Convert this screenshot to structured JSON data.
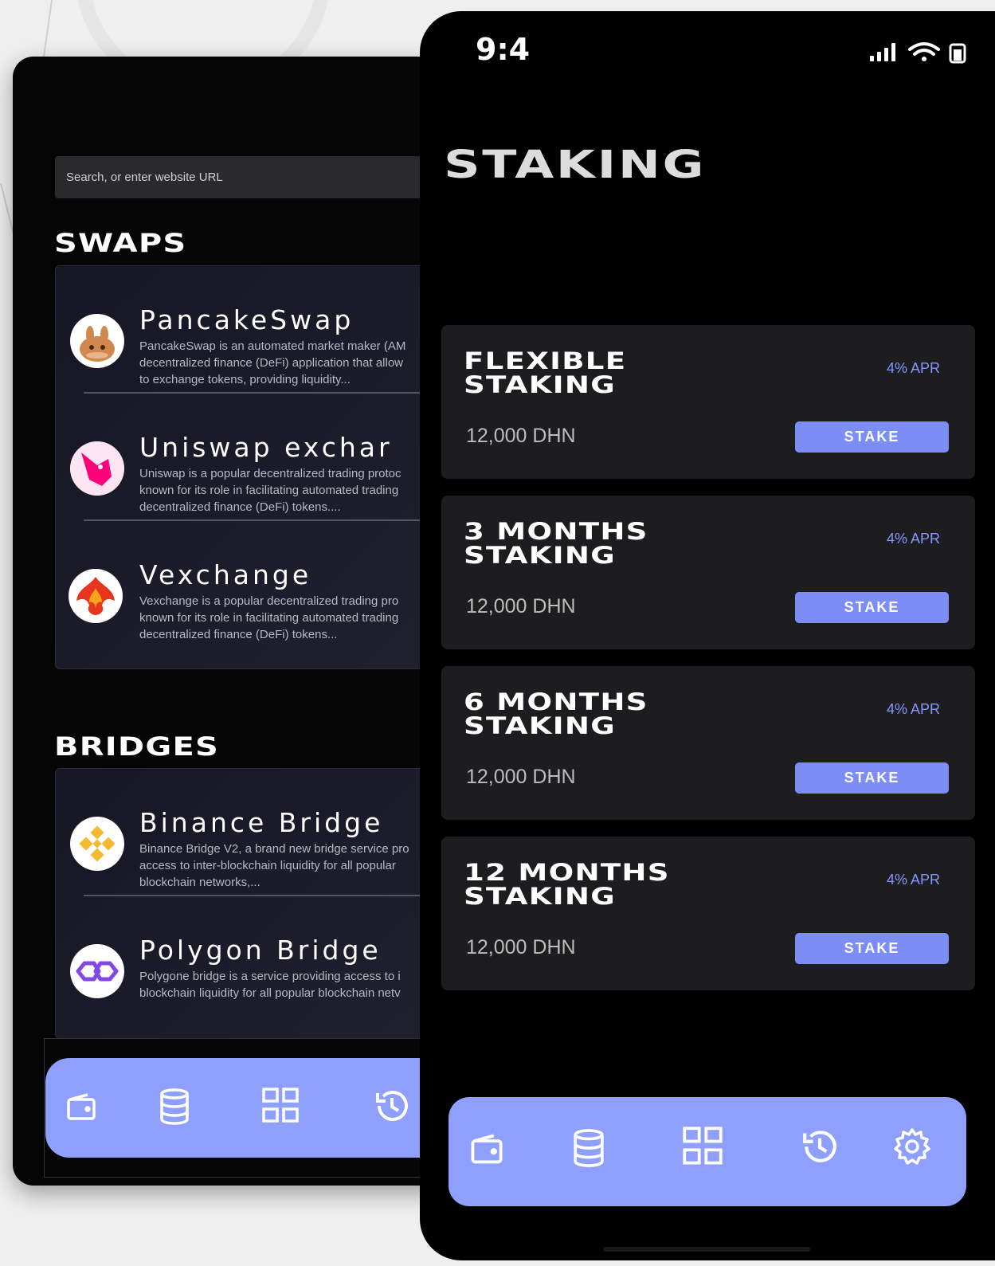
{
  "back_screen": {
    "search": {
      "placeholder": "Search, or enter website URL"
    },
    "swaps_title": "SWAPS",
    "swaps": [
      {
        "name": "PancakeSwap",
        "description": "PancakeSwap is an automated market maker (AM\ndecentralized finance (DeFi) application that allow\nto exchange tokens, providing liquidity...",
        "icon": "pancakeswap-logo"
      },
      {
        "name": "Uniswap exchar",
        "description": "Uniswap is a popular decentralized trading protoc\nknown for its role in facilitating automated trading\ndecentralized finance (DeFi) tokens....",
        "icon": "uniswap-logo"
      },
      {
        "name": "Vexchange",
        "description": "Vexchange is a popular decentralized trading pro\nknown for its role in facilitating automated trading\ndecentralized finance (DeFi) tokens...",
        "icon": "vexchange-logo"
      }
    ],
    "bridges_title": "BRIDGES",
    "bridges": [
      {
        "name": "Binance Bridge",
        "description": "Binance Bridge V2, a brand new bridge service pro\naccess to inter-blockchain liquidity for all popular\nblockchain networks,...",
        "icon": "binance-logo"
      },
      {
        "name": "Polygon Bridge",
        "description": "Polygone  bridge is a service providing access to i\nblockchain liquidity for all popular blockchain netv",
        "icon": "polygon-logo"
      }
    ],
    "nav": [
      "wallet-icon",
      "database-icon",
      "grid-icon",
      "history-icon"
    ]
  },
  "front_screen": {
    "status_time": "9:4",
    "title": "STAKING",
    "stakes": [
      {
        "title": "FLEXIBLE\nSTAKING",
        "apr": "4% APR",
        "amount": "12,000 DHN",
        "button": "STAKE"
      },
      {
        "title": "3 MONTHS\nSTAKING",
        "apr": "4% APR",
        "amount": "12,000 DHN",
        "button": "STAKE"
      },
      {
        "title": "6 MONTHS\nSTAKING",
        "apr": "4% APR",
        "amount": "12,000 DHN",
        "button": "STAKE"
      },
      {
        "title": "12 MONTHS\nSTAKING",
        "apr": "4% APR",
        "amount": "12,000 DHN",
        "button": "STAKE"
      }
    ],
    "nav": [
      "wallet-icon",
      "database-icon",
      "grid-icon",
      "history-icon",
      "settings-icon"
    ]
  },
  "colors": {
    "accent": "#8f9ffc",
    "button": "#7d8df6",
    "apr": "#8796ff"
  }
}
